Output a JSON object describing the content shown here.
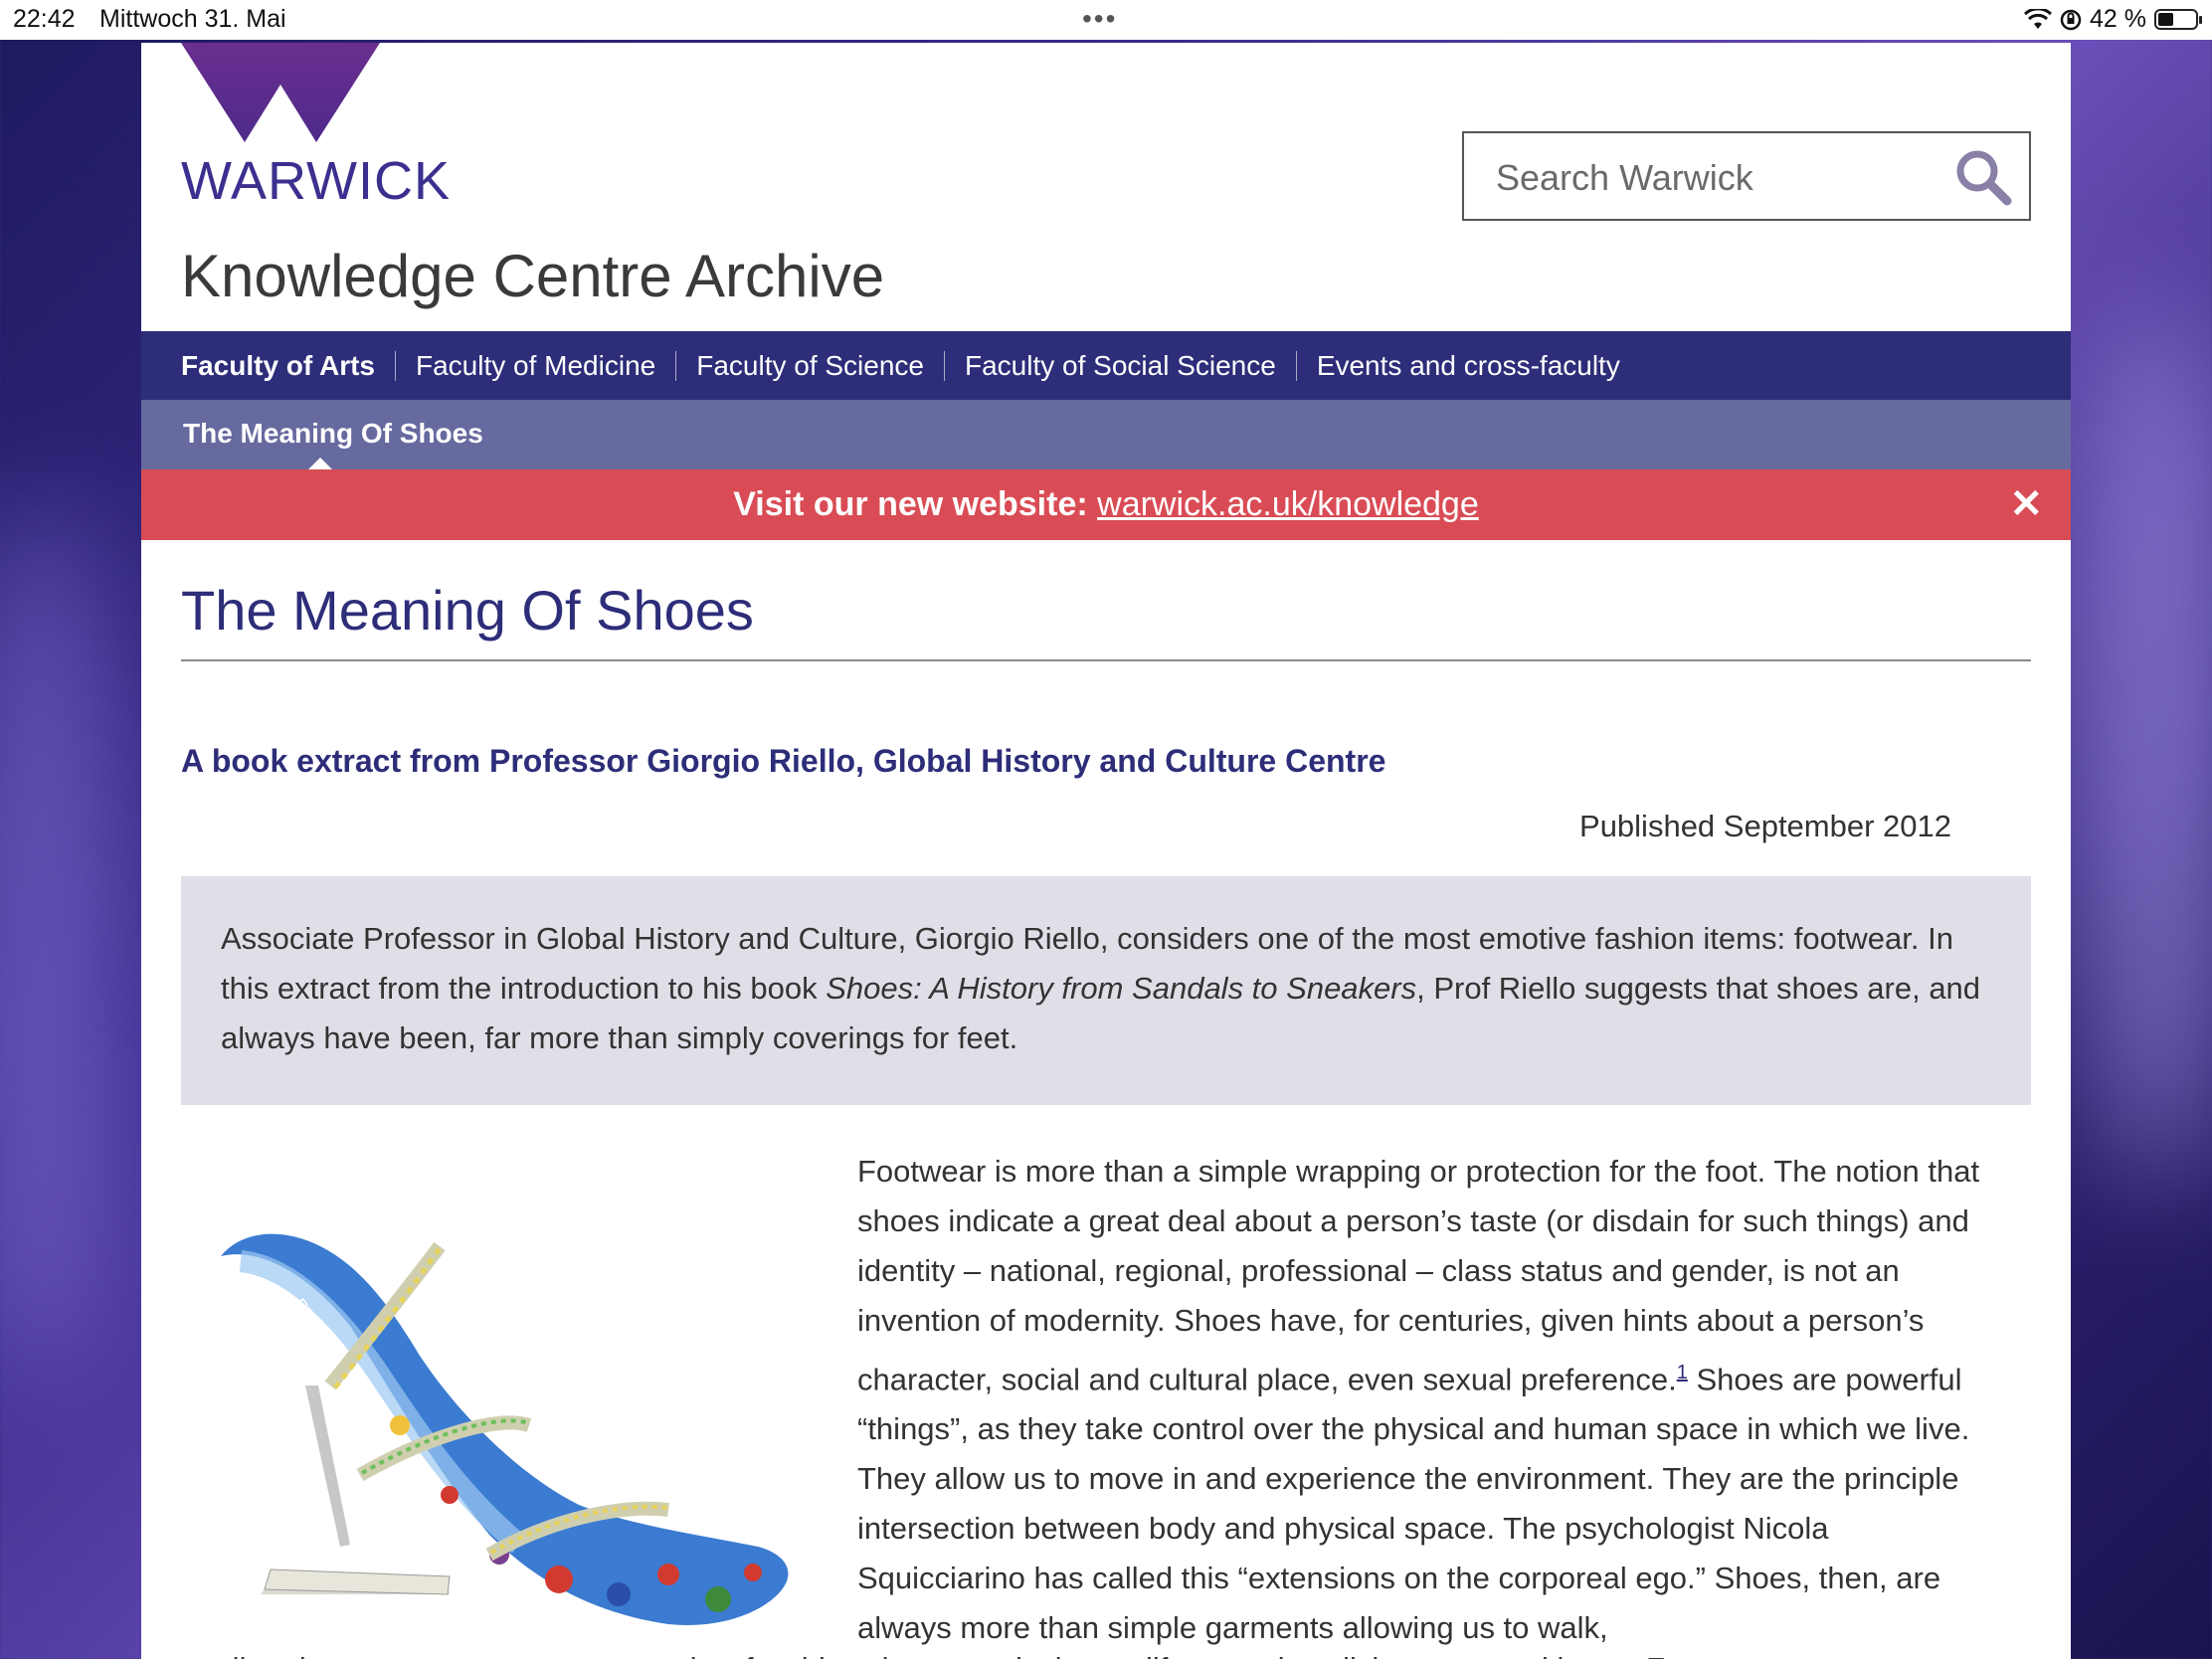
{
  "status_bar": {
    "time": "22:42",
    "date": "Mittwoch 31. Mai",
    "battery": "42 %",
    "battery_level": 0.42
  },
  "header": {
    "logo_word": "WARWICK",
    "site_title": "Knowledge Centre Archive",
    "search_placeholder": "Search Warwick"
  },
  "nav": {
    "items": [
      {
        "label": "Faculty of Arts"
      },
      {
        "label": "Faculty of Medicine"
      },
      {
        "label": "Faculty of Science"
      },
      {
        "label": "Faculty of Social Science"
      },
      {
        "label": "Events and cross-faculty"
      }
    ]
  },
  "subnav": {
    "current": "The Meaning Of Shoes"
  },
  "banner": {
    "prefix": "Visit our new website:",
    "link": "warwick.ac.uk/knowledge",
    "close": "✕"
  },
  "article": {
    "title": "The Meaning Of Shoes",
    "lead": "A book extract from Professor Giorgio Riello, Global History and Culture Centre",
    "published": "Published September 2012",
    "abstract_part1": "Associate Professor in Global History and Culture, Giorgio Riello, considers one of the most emotive fashion items: footwear. In this extract from the introduction to his book ",
    "abstract_italic": "Shoes: A History from Sandals to Sneakers",
    "abstract_part2": ", Prof Riello suggests that shoes are, and always have been, far more than simply coverings for feet.",
    "body_part1": "Footwear is more than a simple wrapping or protection for the foot. The notion that shoes indicate a great deal about a person’s taste (or disdain for such things) and identity – national, regional, professional – class status and gender, is not an invention of modernity. Shoes have, for centuries, given hints about a person’s character, social and cultural place, even sexual preference.",
    "footnote": "1",
    "body_part2": " Shoes are powerful “things”, as they take control over the physical and human space in which we live. They allow us to move in and experience the environment. They are the principle intersection between body and physical space. The psychologist Nicola Squicciarino has called this “extensions on the corporeal ego.” Shoes, then, are always more than simple garments allowing us to walk,",
    "body_cut": "stroll and … construct our own … and … f … ld … the … study that … life … and … disl … a … position … F …"
  },
  "colors": {
    "nav": "#2d2d79",
    "subnav": "#676a9f",
    "banner": "#d94c55",
    "abstract_bg": "#dfdfe8",
    "brand": "#3b2f8f"
  }
}
